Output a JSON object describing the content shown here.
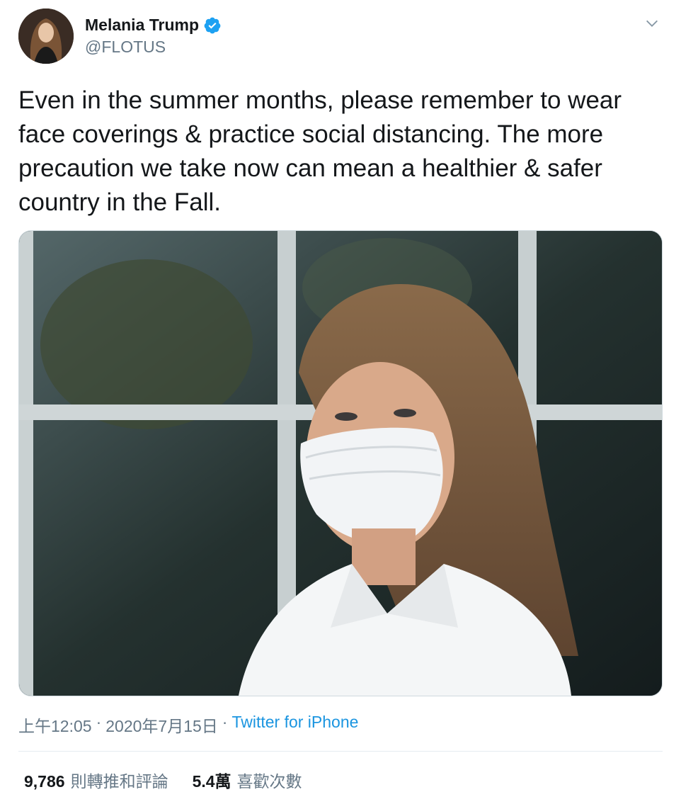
{
  "author": {
    "display_name": "Melania Trump",
    "handle": "@FLOTUS",
    "verified": true,
    "avatar_icon": "profile-photo"
  },
  "tweet": {
    "text": "Even in the summer months, please remember to wear face coverings & practice social distancing. The more precaution we take now can mean a healthier & safer country in the Fall.",
    "media_description_icon": "photo-woman-face-mask"
  },
  "meta": {
    "time": "上午12:05",
    "separator": "·",
    "date": "2020年7月15日",
    "source": "Twitter for iPhone"
  },
  "stats": {
    "retweets_count": "9,786",
    "retweets_label": "則轉推和評論",
    "likes_count": "5.4萬",
    "likes_label": "喜歡次數"
  },
  "colors": {
    "verified_blue": "#1da1f2",
    "link_blue": "#1b95e0",
    "secondary_text": "#657786"
  }
}
